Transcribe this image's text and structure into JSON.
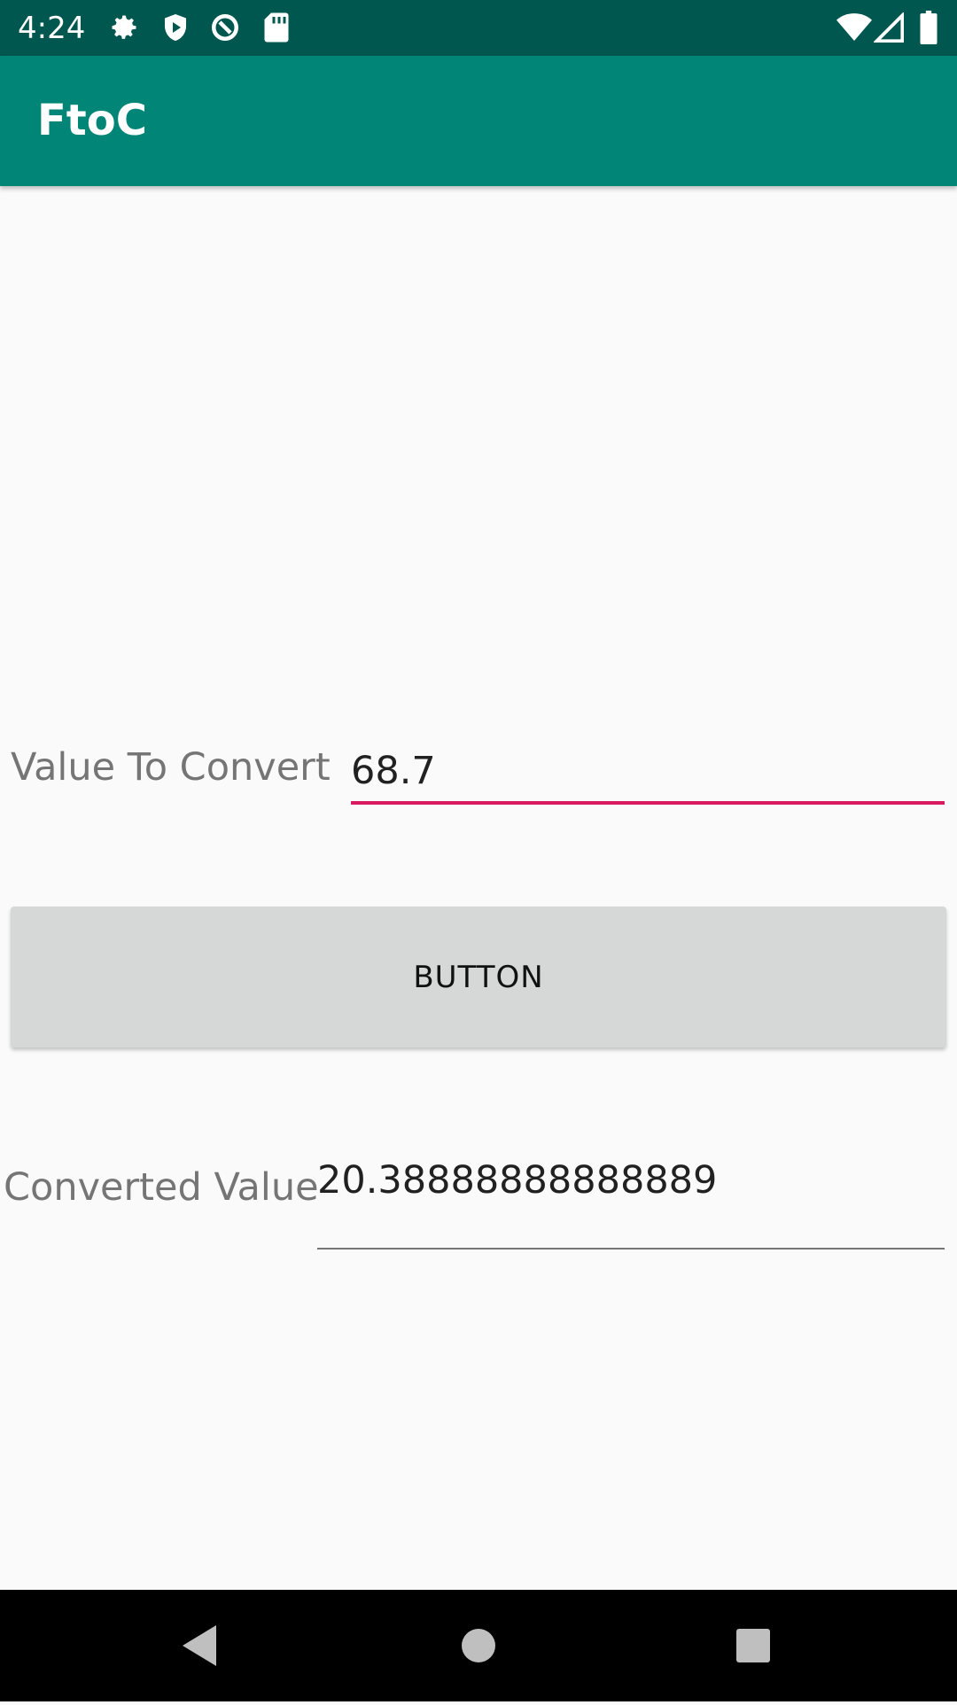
{
  "status_bar": {
    "time": "4:24",
    "icons_left": [
      "gear-icon",
      "shield-icon",
      "data-saver-icon",
      "sd-card-icon"
    ],
    "icons_right": [
      "wifi-icon",
      "cell-signal-icon",
      "battery-icon"
    ]
  },
  "app_bar": {
    "title": "FtoC"
  },
  "form": {
    "input_label": "Value To Convert",
    "input_value": "68.7",
    "button_label": "BUTTON",
    "result_label": "Converted Value",
    "result_value": "20.38888888888889"
  },
  "nav_bar": {
    "buttons": [
      "back-icon",
      "home-icon",
      "recents-icon"
    ]
  },
  "colors": {
    "status_bar": "#00574f",
    "app_bar": "#008577",
    "accent": "#d81b60",
    "background": "#fafafa",
    "button": "#d6d7d7"
  }
}
